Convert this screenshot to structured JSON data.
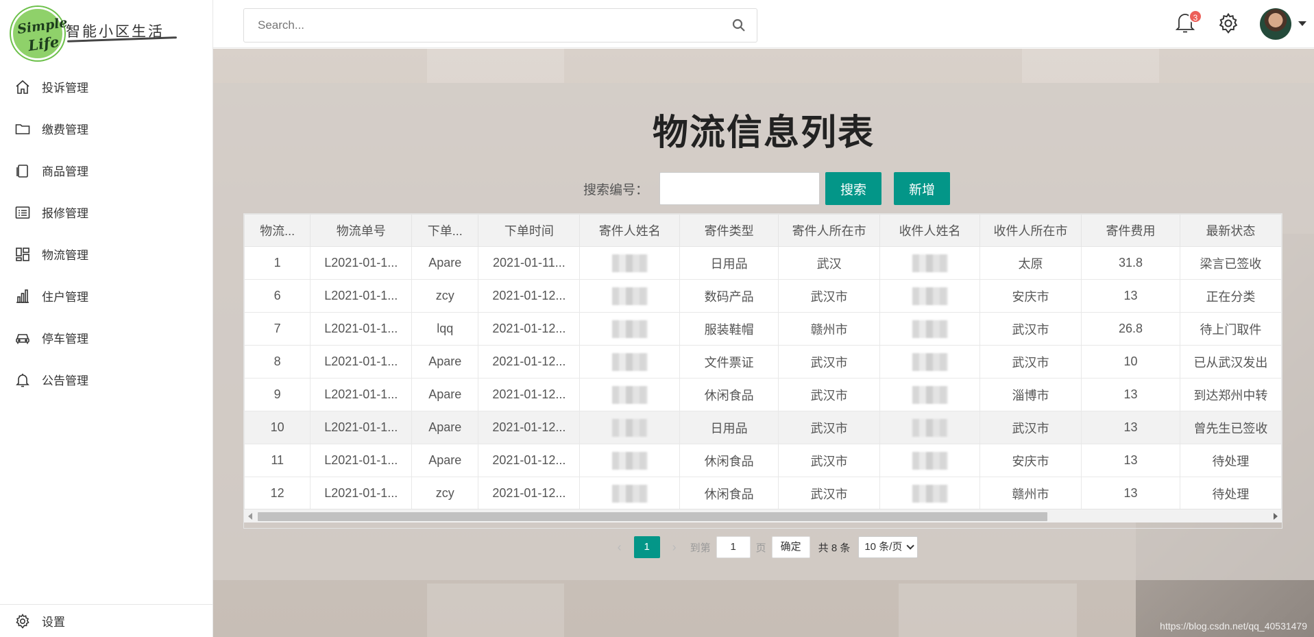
{
  "logo": {
    "mark_line1": "Simple",
    "mark_line2": "Life",
    "text": "智能小区生活"
  },
  "sidebar": {
    "items": [
      {
        "label": "投诉管理",
        "icon": "home-icon"
      },
      {
        "label": "缴费管理",
        "icon": "folder-icon"
      },
      {
        "label": "商品管理",
        "icon": "copy-icon"
      },
      {
        "label": "报修管理",
        "icon": "list-icon"
      },
      {
        "label": "物流管理",
        "icon": "grid-icon"
      },
      {
        "label": "住户管理",
        "icon": "bar-chart-icon"
      },
      {
        "label": "停车管理",
        "icon": "car-icon"
      },
      {
        "label": "公告管理",
        "icon": "bell-icon"
      }
    ],
    "settings_label": "设置"
  },
  "header": {
    "search_placeholder": "Search...",
    "notification_count": "3"
  },
  "page": {
    "title": "物流信息列表",
    "search_label": "搜索编号：",
    "search_button": "搜索",
    "add_button": "新增"
  },
  "table": {
    "columns": [
      "物流...",
      "物流单号",
      "下单...",
      "下单时间",
      "寄件人姓名",
      "寄件类型",
      "寄件人所在市",
      "收件人姓名",
      "收件人所在市",
      "寄件费用",
      "最新状态"
    ],
    "rows": [
      [
        "1",
        "L2021-01-1...",
        "Apare",
        "2021-01-11...",
        "",
        "日用品",
        "武汉",
        "",
        "太原",
        "31.8",
        "梁言已签收"
      ],
      [
        "6",
        "L2021-01-1...",
        "zcy",
        "2021-01-12...",
        "",
        "数码产品",
        "武汉市",
        "",
        "安庆市",
        "13",
        "正在分类"
      ],
      [
        "7",
        "L2021-01-1...",
        "lqq",
        "2021-01-12...",
        "",
        "服装鞋帽",
        "赣州市",
        "",
        "武汉市",
        "26.8",
        "待上门取件"
      ],
      [
        "8",
        "L2021-01-1...",
        "Apare",
        "2021-01-12...",
        "",
        "文件票证",
        "武汉市",
        "",
        "武汉市",
        "10",
        "已从武汉发出"
      ],
      [
        "9",
        "L2021-01-1...",
        "Apare",
        "2021-01-12...",
        "",
        "休闲食品",
        "武汉市",
        "",
        "淄博市",
        "13",
        "到达郑州中转"
      ],
      [
        "10",
        "L2021-01-1...",
        "Apare",
        "2021-01-12...",
        "",
        "日用品",
        "武汉市",
        "",
        "武汉市",
        "13",
        "曾先生已签收"
      ],
      [
        "11",
        "L2021-01-1...",
        "Apare",
        "2021-01-12...",
        "",
        "休闲食品",
        "武汉市",
        "",
        "安庆市",
        "13",
        "待处理"
      ],
      [
        "12",
        "L2021-01-1...",
        "zcy",
        "2021-01-12...",
        "",
        "休闲食品",
        "武汉市",
        "",
        "赣州市",
        "13",
        "待处理"
      ]
    ]
  },
  "pagination": {
    "current_page": "1",
    "goto_label": "到第",
    "goto_value": "1",
    "page_unit": "页",
    "confirm_label": "确定",
    "total_label": "共 8 条",
    "page_size": "10 条/页"
  },
  "watermark": "https://blog.csdn.net/qq_40531479",
  "colors": {
    "accent": "#039688",
    "badge": "#ec5f59"
  }
}
